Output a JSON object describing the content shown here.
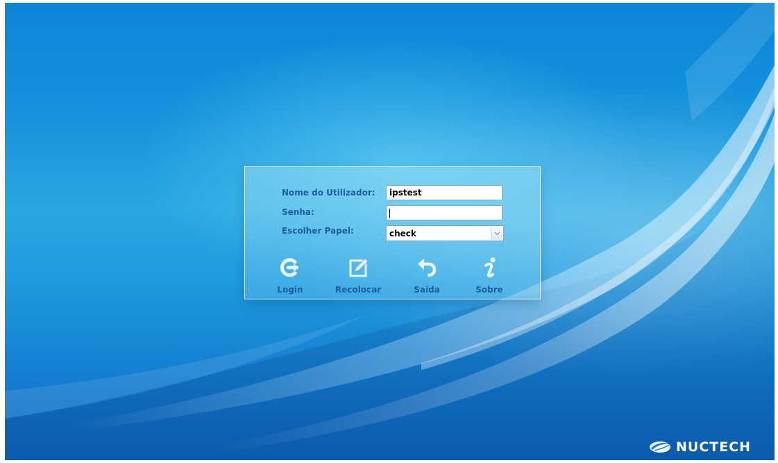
{
  "login": {
    "username_label": "Nome do Utilizador:",
    "username_value": "ipstest",
    "password_label": "Senha:",
    "password_value": "",
    "role_label": "Escolher Papel:",
    "role_selected": "check"
  },
  "actions": [
    {
      "label": "Login",
      "icon": "login-arrow-icon"
    },
    {
      "label": "Recolocar",
      "icon": "edit-icon"
    },
    {
      "label": "Saída",
      "icon": "undo-arrow-icon"
    },
    {
      "label": "Sobre",
      "icon": "info-icon"
    }
  ],
  "brand": {
    "name": "NUCTECH",
    "logo_icon": "nuctech-logo-icon"
  },
  "colors": {
    "label_text": "#1b5e9e",
    "background": "#1593dd",
    "icon_fill": "#eaf6fd"
  }
}
